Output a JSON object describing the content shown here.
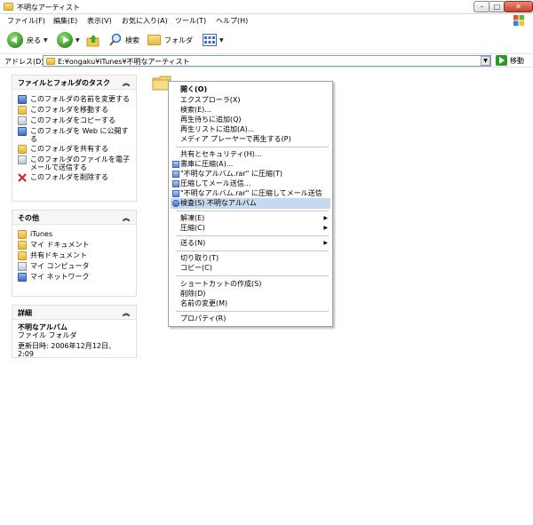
{
  "window": {
    "title": "不明なアーティスト",
    "controls": {
      "minimize": "–",
      "maximize": "□",
      "close": "✕"
    }
  },
  "menubar": {
    "items": [
      "ファイル(F)",
      "編集(E)",
      "表示(V)",
      "お気に入り(A)",
      "ツール(T)",
      "ヘルプ(H)"
    ]
  },
  "toolbar": {
    "back_label": "戻る",
    "search_label": "検索",
    "folders_label": "フォルダ"
  },
  "address": {
    "label": "アドレス(D)",
    "value": "E:¥ongaku¥iTunes¥不明なアーティスト",
    "go_label": "移動"
  },
  "tasks_pane": {
    "title": "ファイルとフォルダのタスク",
    "items": [
      "このフォルダの名前を変更する",
      "このフォルダを移動する",
      "このフォルダをコピーする",
      "このフォルダを Web に公開する",
      "このフォルダを共有する",
      "このフォルダのファイルを電子メールで送信する",
      "このフォルダを削除する"
    ]
  },
  "other_pane": {
    "title": "その他",
    "items": [
      "iTunes",
      "マイ ドキュメント",
      "共有ドキュメント",
      "マイ コンピュータ",
      "マイ ネットワーク"
    ]
  },
  "details_pane": {
    "title": "詳細",
    "name": "不明なアルバム",
    "type": "ファイル フォルダ",
    "modified": "更新日時: 2006年12月12日、2:09"
  },
  "context_menu": {
    "items": [
      "開く(O)",
      "エクスプローラ(X)",
      "検索(E)...",
      "再生待ちに追加(Q)",
      "再生リストに追加(A)...",
      "メディア プレーヤーで再生する(P)",
      "共有とセキュリティ(H)...",
      "書庫に圧縮(A)...",
      "\"不明なアルバム.rar\" に圧縮(T)",
      "圧縮してメール送信...",
      "\"不明なアルバム.rar\" に圧縮してメール送信",
      "検査(S) 不明なアルバム",
      "解凍(E)",
      "圧縮(C)",
      "送る(N)",
      "切り取り(T)",
      "コピー(C)",
      "ショートカットの作成(S)",
      "削除(D)",
      "名前の変更(M)",
      "プロパティ(R)"
    ]
  }
}
